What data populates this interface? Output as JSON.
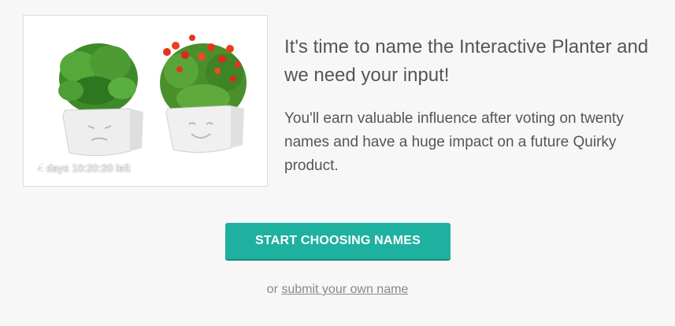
{
  "hero": {
    "timer_text": "4 days 10:20:20 left"
  },
  "content": {
    "headline": "It's time to name the Interactive Planter and we need your input!",
    "description": "You'll earn valuable influence after voting on twenty names and have a huge impact on a future Quirky product."
  },
  "actions": {
    "start_label": "START CHOOSING NAMES",
    "alt_prefix": "or",
    "alt_link": "submit your own name"
  },
  "colors": {
    "accent": "#1fb1a0",
    "text": "#555555",
    "muted": "#888888",
    "background": "#f7f7f7"
  }
}
